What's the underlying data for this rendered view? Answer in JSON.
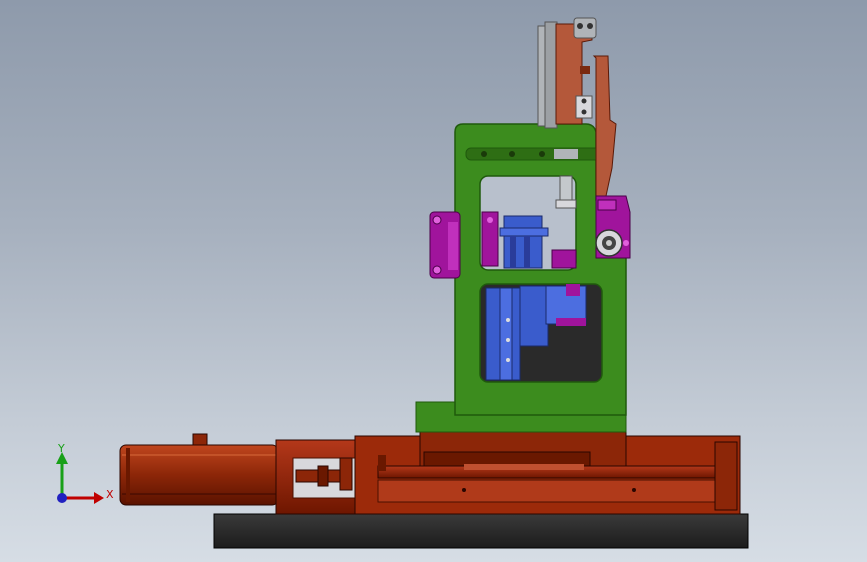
{
  "view": {
    "model": "linear-actuator-assembly",
    "view_orientation": "front"
  },
  "triad": {
    "x_label": "X",
    "y_label": "Y"
  },
  "colors": {
    "frame_green": "#3c8c1e",
    "frame_green_dark": "#1f5a0c",
    "rail_red": "#9c2a0a",
    "rail_red_dark": "#5a1200",
    "slide_copper": "#b4583a",
    "carriage_blue": "#3a5ccc",
    "bracket_magenta": "#a0149c",
    "base_black": "#2c2c2c",
    "steel_gray": "#b0b4b8"
  }
}
